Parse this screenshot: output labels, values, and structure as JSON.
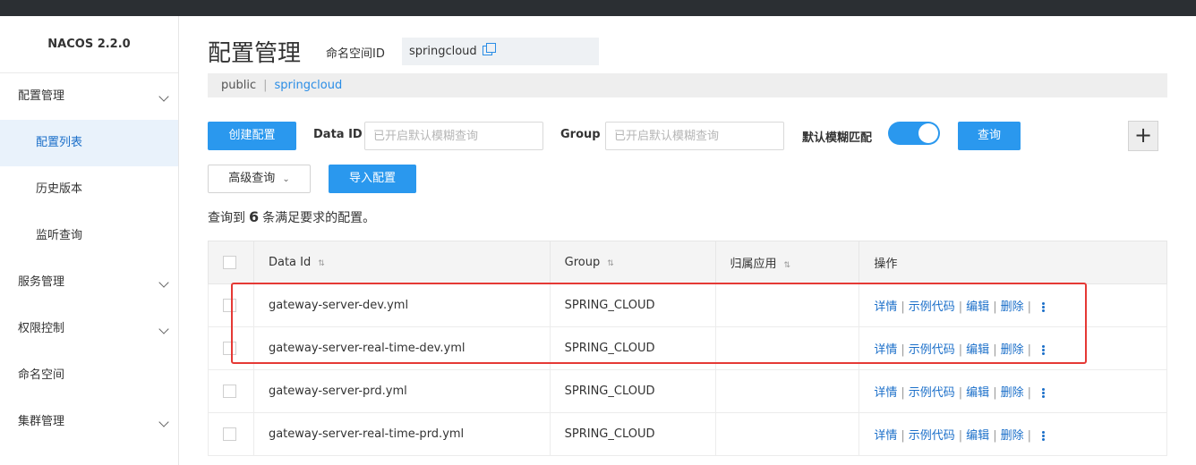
{
  "app": {
    "logo": "NACOS 2.2.0"
  },
  "sidebar": {
    "items": [
      {
        "label": "配置管理",
        "expandable": true
      },
      {
        "label": "配置列表",
        "sub": true,
        "active": true
      },
      {
        "label": "历史版本",
        "sub": true
      },
      {
        "label": "监听查询",
        "sub": true
      },
      {
        "label": "服务管理",
        "expandable": true
      },
      {
        "label": "权限控制",
        "expandable": true
      },
      {
        "label": "命名空间",
        "expandable": false
      },
      {
        "label": "集群管理",
        "expandable": true
      }
    ]
  },
  "header": {
    "title": "配置管理",
    "namespace_label": "命名空间ID",
    "namespace_value": "springcloud"
  },
  "namespace_bar": {
    "public": "public",
    "separator": "|",
    "current": "springcloud"
  },
  "toolbar": {
    "create_label": "创建配置",
    "dataid_label": "Data ID",
    "dataid_placeholder": "已开启默认模糊查询",
    "group_label": "Group",
    "group_placeholder": "已开启默认模糊查询",
    "fuzzy_label": "默认模糊匹配",
    "fuzzy_on": true,
    "query_label": "查询",
    "plus_symbol": "+",
    "advanced_label": "高级查询",
    "advanced_caret": "⌄",
    "import_label": "导入配置"
  },
  "summary": {
    "prefix": "查询到",
    "count": "6",
    "suffix": "条满足要求的配置。"
  },
  "table": {
    "headers": {
      "dataid": "Data Id",
      "group": "Group",
      "app": "归属应用",
      "ops": "操作"
    },
    "sort_glyph": "⇅",
    "ops_labels": {
      "detail": "详情",
      "sample": "示例代码",
      "edit": "编辑",
      "delete": "删除"
    },
    "rows": [
      {
        "dataid": "gateway-server-dev.yml",
        "group": "SPRING_CLOUD",
        "app": ""
      },
      {
        "dataid": "gateway-server-real-time-dev.yml",
        "group": "SPRING_CLOUD",
        "app": ""
      },
      {
        "dataid": "gateway-server-prd.yml",
        "group": "SPRING_CLOUD",
        "app": ""
      },
      {
        "dataid": "gateway-server-real-time-prd.yml",
        "group": "SPRING_CLOUD",
        "app": ""
      }
    ]
  },
  "colors": {
    "accent": "#2a98ee",
    "link": "#1b6fc9",
    "highlight": "#e53935"
  }
}
